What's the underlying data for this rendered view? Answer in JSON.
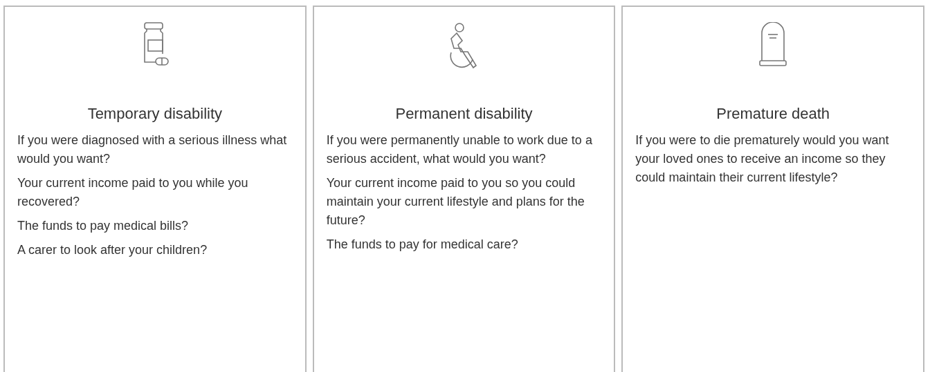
{
  "cards": [
    {
      "kind": "medicine",
      "title": "Temporary disability",
      "paragraphs": [
        "If you were diagnosed with a serious illness what would you want?",
        "Your current income paid to you while you recovered?",
        "The funds to pay medical bills?",
        "A carer to look after your children?"
      ]
    },
    {
      "kind": "wheelchair",
      "title": "Permanent disability",
      "paragraphs": [
        "If you were permanently unable to work due to a serious accident, what would you want?",
        "Your current income paid to you so you could maintain your current lifestyle and plans for the future?",
        "The funds to pay for medical care?"
      ]
    },
    {
      "kind": "gravestone",
      "title": "Premature death",
      "paragraphs": [
        "If you were to die prematurely would you want your loved ones to receive an income so they could maintain their current lifestyle?"
      ]
    }
  ]
}
